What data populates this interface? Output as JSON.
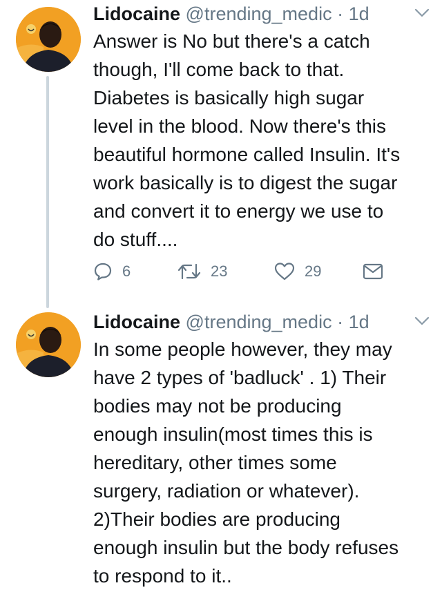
{
  "tweets": [
    {
      "display_name": "Lidocaine",
      "handle": "@trending_medic",
      "separator": "·",
      "timestamp": "1d",
      "text": "Answer is No but there's a catch\nthough, I'll come back to that.\nDiabetes is basically high sugar\nlevel in the blood. Now there's this\nbeautiful hormone called Insulin. It's\nwork basically is to digest the sugar\nand convert it to energy we use to\ndo stuff....",
      "reply_count": "6",
      "retweet_count": "23",
      "like_count": "29"
    },
    {
      "display_name": "Lidocaine",
      "handle": "@trending_medic",
      "separator": "·",
      "timestamp": "1d",
      "text": "In some people however, they may\nhave 2 types of 'badluck' . 1) Their\nbodies may not be producing\nenough insulin(most times this is\nhereditary, other times some\nsurgery, radiation or whatever).\n2)Their bodies are producing\nenough insulin but the body refuses\nto respond to it.."
    }
  ],
  "icons": {
    "reply": "reply-icon",
    "retweet": "retweet-icon",
    "like": "heart-icon",
    "dm": "envelope-icon",
    "menu": "chevron-down-icon"
  },
  "colors": {
    "text": "#14171a",
    "secondary": "#657786",
    "thread_line": "#ccd6dd",
    "avatar_bg": "#f19c1c"
  }
}
